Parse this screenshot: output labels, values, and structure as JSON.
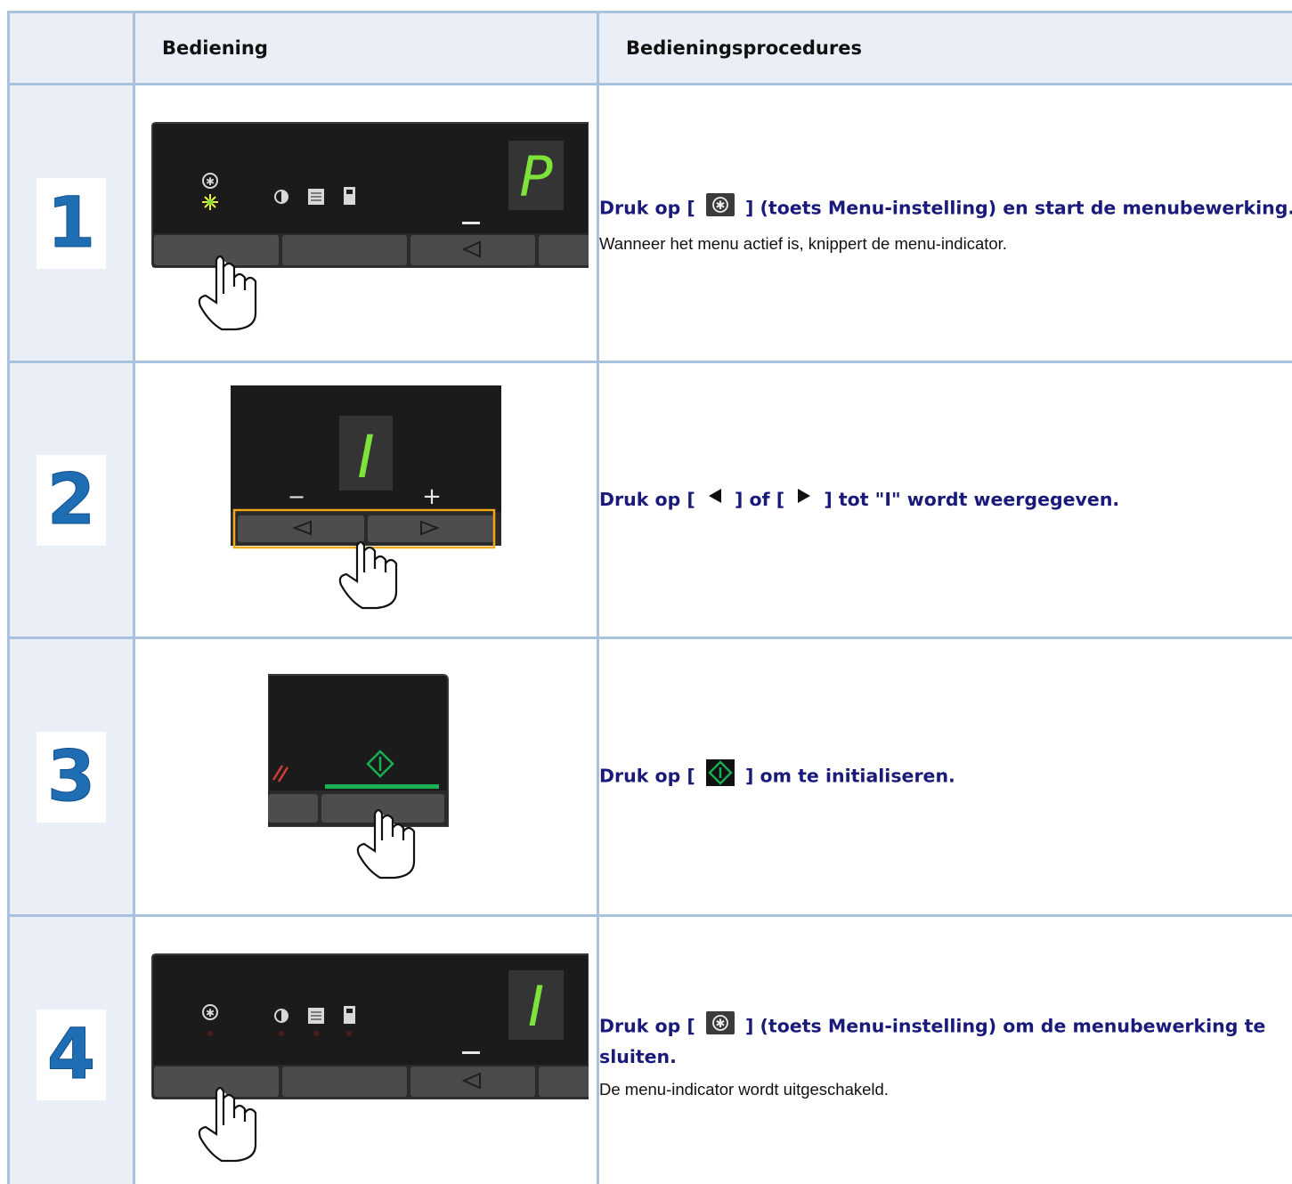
{
  "table": {
    "header": {
      "operation": "Bediening",
      "procedure": "Bedieningsprocedures"
    },
    "steps": [
      {
        "number": "1",
        "illustration": {
          "segment_display": "P",
          "pointer": "menu-setting-key",
          "indicator": "blinking"
        },
        "instruction_before": "Druk op [",
        "icon": "menu-setting-key-icon",
        "instruction_after": "] (toets Menu-instelling) en start de menubewerking.",
        "note": "Wanneer het menu actief is, knippert de menu-indicator."
      },
      {
        "number": "2",
        "illustration": {
          "segment_display": "I",
          "pointer": "arrow-keys",
          "minus": "−",
          "plus": "+"
        },
        "instruction_before": "Druk op [",
        "icon_left": "left-arrow-icon",
        "instruction_mid": "] of [",
        "icon_right": "right-arrow-icon",
        "instruction_after": "] tot \"I\" wordt weergegeven.",
        "note": ""
      },
      {
        "number": "3",
        "illustration": {
          "pointer": "start-key"
        },
        "instruction_before": "Druk op [",
        "icon": "start-key-icon",
        "instruction_after": "] om te initialiseren.",
        "note": ""
      },
      {
        "number": "4",
        "illustration": {
          "segment_display": "I",
          "pointer": "menu-setting-key",
          "indicator": "off"
        },
        "instruction_before": "Druk op [",
        "icon": "menu-setting-key-icon",
        "instruction_after": "] (toets Menu-instelling) om de menubewerking te sluiten.",
        "note": "De menu-indicator wordt uitgeschakeld."
      }
    ]
  },
  "colors": {
    "border": "#a9c3de",
    "header_bg": "#e9eef7",
    "number": "#1f6db2",
    "instruction": "#1a1a7a",
    "segment_green": "#7ee23a",
    "start_green": "#18b050",
    "highlight_orange": "#f0a91a"
  }
}
